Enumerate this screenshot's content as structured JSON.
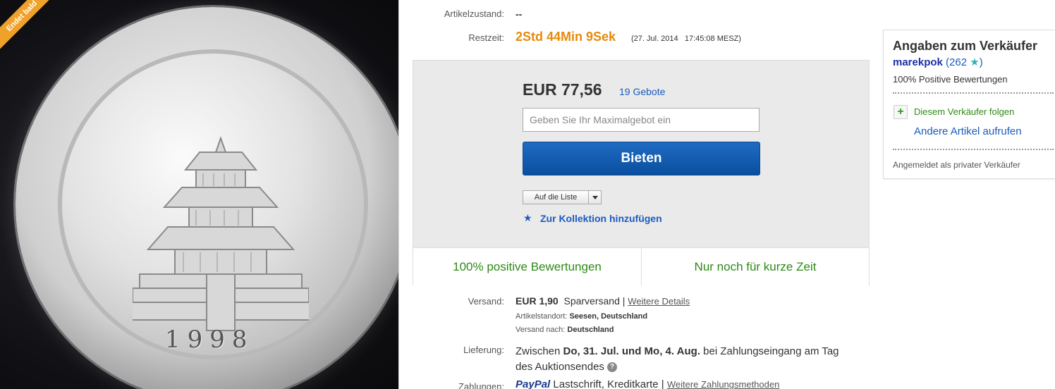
{
  "photo": {
    "ribbon_text": "Endet bald",
    "coin_year": "1998"
  },
  "item": {
    "condition_label": "Artikelzustand:",
    "condition_value": "--",
    "time_left_label": "Restzeit:",
    "time_left_value": "2Std 44Min 9Sek",
    "end_date": "(27. Jul. 2014   17:45:08 MESZ)"
  },
  "bid": {
    "price": "EUR 77,56",
    "bid_count": "19 Gebote",
    "input_placeholder": "Geben Sie Ihr Maximalgebot ein",
    "bid_button": "Bieten",
    "watch_button": "Auf die Liste",
    "collection_link": "Zur Kollektion hinzufügen",
    "highlight_left": "100% positive Bewertungen",
    "highlight_right": "Nur noch für kurze Zeit"
  },
  "shipping": {
    "label": "Versand:",
    "cost": "EUR 1,90",
    "method": "Sparversand |",
    "details_link": "Weitere Details",
    "location_label": "Artikelstandort:",
    "location_value": "Seesen, Deutschland",
    "ships_to_label": "Versand nach:",
    "ships_to_value": "Deutschland"
  },
  "delivery": {
    "label": "Lieferung:",
    "prefix": "Zwischen",
    "range": "Do, 31. Jul. und Mo, 4. Aug.",
    "suffix": "bei Zahlungseingang am Tag",
    "line2": "des Auktionsendes"
  },
  "payment": {
    "label": "Zahlungen:",
    "paypal": "PayPal",
    "methods": "Lastschrift,  Kreditkarte  |",
    "more_link": "Weitere Zahlungsmethoden"
  },
  "seller": {
    "title": "Angaben zum Verkäufer",
    "name": "marekpok",
    "score_open": "(",
    "score": "262",
    "score_close": ")",
    "feedback": "100% Positive Bewertungen",
    "follow": "Diesem Verkäufer folgen",
    "other_items": "Andere Artikel aufrufen",
    "seller_type": "Angemeldet als privater Verkäufer"
  },
  "colors": {
    "accent_orange": "#e58a0c",
    "bid_blue": "#0a56a8",
    "positive_green": "#2e8a16",
    "link_blue": "#1a5bbf"
  }
}
